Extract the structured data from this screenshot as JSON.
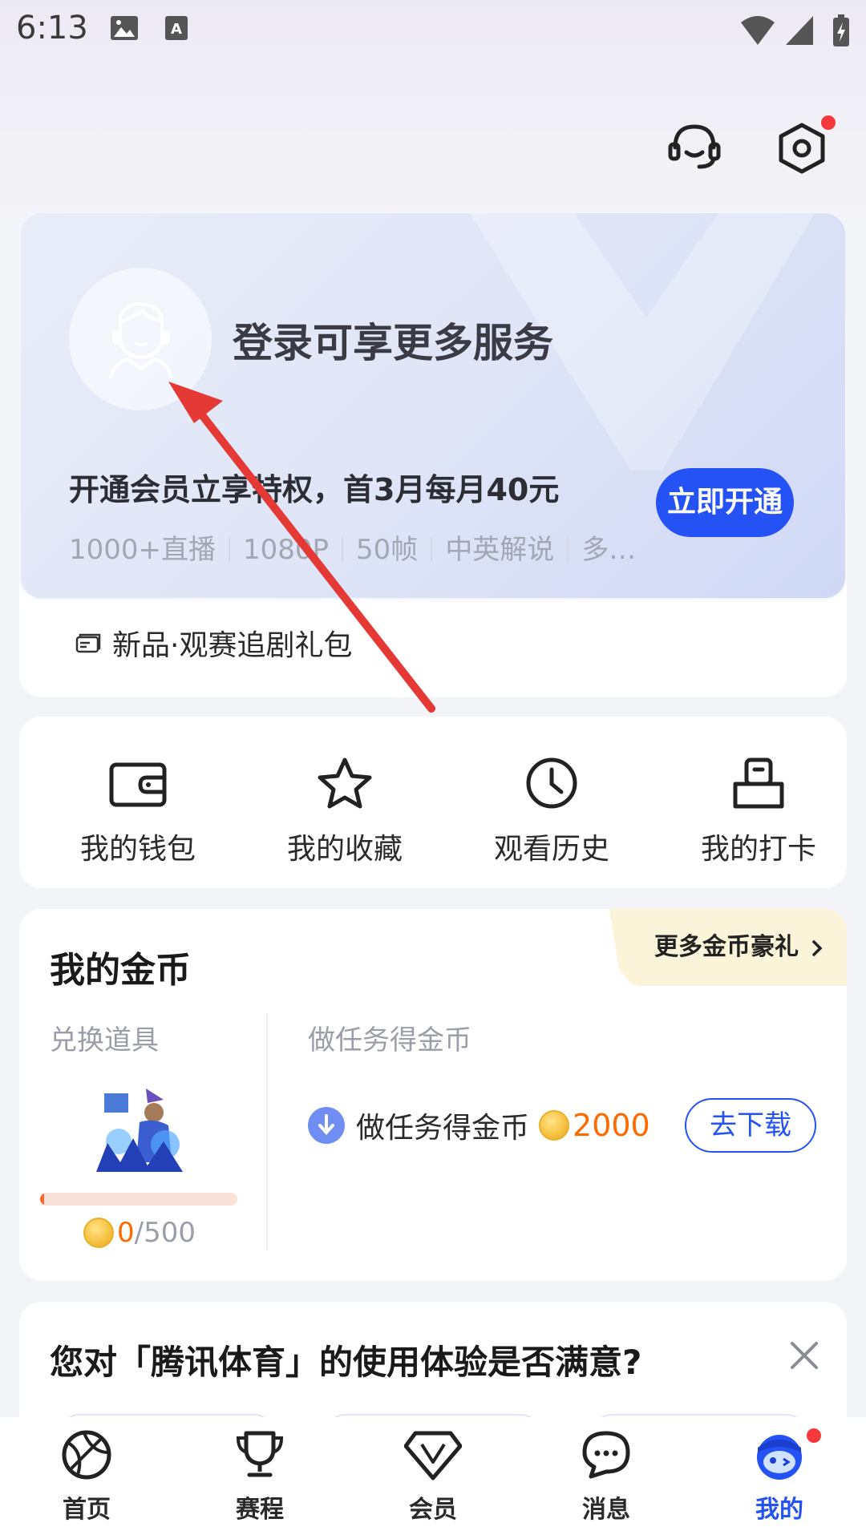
{
  "status_bar": {
    "time": "6:13"
  },
  "header": {
    "support_icon": "headset-icon",
    "settings_icon": "hexagon-gear-icon",
    "settings_has_dot": true
  },
  "login_card": {
    "title": "登录可享更多服务",
    "vip_promo": "开通会员立享特权，首3月每月40元",
    "features": [
      "1000+直播",
      "1080P",
      "50帧",
      "中英解说",
      "多…"
    ],
    "open_button": "立即开通",
    "gift_text": "新品·观赛追剧礼包"
  },
  "quick_actions": [
    {
      "label": "我的钱包",
      "icon": "wallet-icon"
    },
    {
      "label": "我的收藏",
      "icon": "star-icon"
    },
    {
      "label": "观看历史",
      "icon": "clock-icon"
    },
    {
      "label": "我的打卡",
      "icon": "checkin-icon"
    }
  ],
  "coins": {
    "title": "我的金币",
    "more_link": "更多金币豪礼",
    "exchange_label": "兑换道具",
    "task_label": "做任务得金币",
    "progress_current": "0",
    "progress_total": "/500",
    "progress_fraction": 0.02,
    "task_text": "做任务得金币",
    "task_amount": "2000",
    "download_button": "去下载"
  },
  "survey": {
    "title": "您对「腾讯体育」的使用体验是否满意?"
  },
  "tabs": [
    {
      "label": "首页",
      "icon": "basketball-icon"
    },
    {
      "label": "赛程",
      "icon": "trophy-icon"
    },
    {
      "label": "会员",
      "icon": "diamond-icon"
    },
    {
      "label": "消息",
      "icon": "chat-icon"
    },
    {
      "label": "我的",
      "icon": "profile-mascot-icon",
      "active": true
    }
  ],
  "colors": {
    "accent": "#2552f5",
    "coin_orange": "#ff6a00",
    "badge_red": "#f5383b",
    "annotation_arrow": "#e53935"
  }
}
